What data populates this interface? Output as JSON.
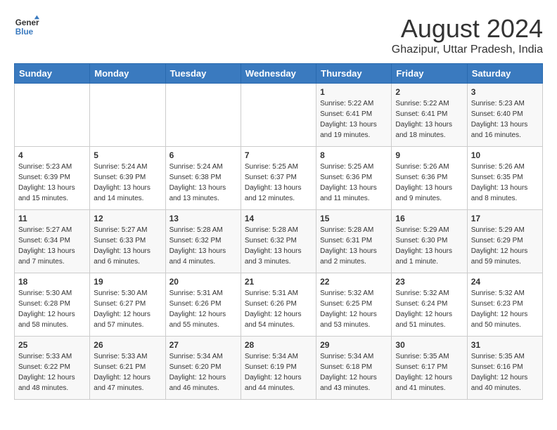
{
  "header": {
    "logo_line1": "General",
    "logo_line2": "Blue",
    "month_year": "August 2024",
    "location": "Ghazipur, Uttar Pradesh, India"
  },
  "days_of_week": [
    "Sunday",
    "Monday",
    "Tuesday",
    "Wednesday",
    "Thursday",
    "Friday",
    "Saturday"
  ],
  "weeks": [
    [
      {
        "day": "",
        "sunrise": "",
        "sunset": "",
        "daylight": ""
      },
      {
        "day": "",
        "sunrise": "",
        "sunset": "",
        "daylight": ""
      },
      {
        "day": "",
        "sunrise": "",
        "sunset": "",
        "daylight": ""
      },
      {
        "day": "",
        "sunrise": "",
        "sunset": "",
        "daylight": ""
      },
      {
        "day": "1",
        "sunrise": "Sunrise: 5:22 AM",
        "sunset": "Sunset: 6:41 PM",
        "daylight": "Daylight: 13 hours and 19 minutes."
      },
      {
        "day": "2",
        "sunrise": "Sunrise: 5:22 AM",
        "sunset": "Sunset: 6:41 PM",
        "daylight": "Daylight: 13 hours and 18 minutes."
      },
      {
        "day": "3",
        "sunrise": "Sunrise: 5:23 AM",
        "sunset": "Sunset: 6:40 PM",
        "daylight": "Daylight: 13 hours and 16 minutes."
      }
    ],
    [
      {
        "day": "4",
        "sunrise": "Sunrise: 5:23 AM",
        "sunset": "Sunset: 6:39 PM",
        "daylight": "Daylight: 13 hours and 15 minutes."
      },
      {
        "day": "5",
        "sunrise": "Sunrise: 5:24 AM",
        "sunset": "Sunset: 6:39 PM",
        "daylight": "Daylight: 13 hours and 14 minutes."
      },
      {
        "day": "6",
        "sunrise": "Sunrise: 5:24 AM",
        "sunset": "Sunset: 6:38 PM",
        "daylight": "Daylight: 13 hours and 13 minutes."
      },
      {
        "day": "7",
        "sunrise": "Sunrise: 5:25 AM",
        "sunset": "Sunset: 6:37 PM",
        "daylight": "Daylight: 13 hours and 12 minutes."
      },
      {
        "day": "8",
        "sunrise": "Sunrise: 5:25 AM",
        "sunset": "Sunset: 6:36 PM",
        "daylight": "Daylight: 13 hours and 11 minutes."
      },
      {
        "day": "9",
        "sunrise": "Sunrise: 5:26 AM",
        "sunset": "Sunset: 6:36 PM",
        "daylight": "Daylight: 13 hours and 9 minutes."
      },
      {
        "day": "10",
        "sunrise": "Sunrise: 5:26 AM",
        "sunset": "Sunset: 6:35 PM",
        "daylight": "Daylight: 13 hours and 8 minutes."
      }
    ],
    [
      {
        "day": "11",
        "sunrise": "Sunrise: 5:27 AM",
        "sunset": "Sunset: 6:34 PM",
        "daylight": "Daylight: 13 hours and 7 minutes."
      },
      {
        "day": "12",
        "sunrise": "Sunrise: 5:27 AM",
        "sunset": "Sunset: 6:33 PM",
        "daylight": "Daylight: 13 hours and 6 minutes."
      },
      {
        "day": "13",
        "sunrise": "Sunrise: 5:28 AM",
        "sunset": "Sunset: 6:32 PM",
        "daylight": "Daylight: 13 hours and 4 minutes."
      },
      {
        "day": "14",
        "sunrise": "Sunrise: 5:28 AM",
        "sunset": "Sunset: 6:32 PM",
        "daylight": "Daylight: 13 hours and 3 minutes."
      },
      {
        "day": "15",
        "sunrise": "Sunrise: 5:28 AM",
        "sunset": "Sunset: 6:31 PM",
        "daylight": "Daylight: 13 hours and 2 minutes."
      },
      {
        "day": "16",
        "sunrise": "Sunrise: 5:29 AM",
        "sunset": "Sunset: 6:30 PM",
        "daylight": "Daylight: 13 hours and 1 minute."
      },
      {
        "day": "17",
        "sunrise": "Sunrise: 5:29 AM",
        "sunset": "Sunset: 6:29 PM",
        "daylight": "Daylight: 12 hours and 59 minutes."
      }
    ],
    [
      {
        "day": "18",
        "sunrise": "Sunrise: 5:30 AM",
        "sunset": "Sunset: 6:28 PM",
        "daylight": "Daylight: 12 hours and 58 minutes."
      },
      {
        "day": "19",
        "sunrise": "Sunrise: 5:30 AM",
        "sunset": "Sunset: 6:27 PM",
        "daylight": "Daylight: 12 hours and 57 minutes."
      },
      {
        "day": "20",
        "sunrise": "Sunrise: 5:31 AM",
        "sunset": "Sunset: 6:26 PM",
        "daylight": "Daylight: 12 hours and 55 minutes."
      },
      {
        "day": "21",
        "sunrise": "Sunrise: 5:31 AM",
        "sunset": "Sunset: 6:26 PM",
        "daylight": "Daylight: 12 hours and 54 minutes."
      },
      {
        "day": "22",
        "sunrise": "Sunrise: 5:32 AM",
        "sunset": "Sunset: 6:25 PM",
        "daylight": "Daylight: 12 hours and 53 minutes."
      },
      {
        "day": "23",
        "sunrise": "Sunrise: 5:32 AM",
        "sunset": "Sunset: 6:24 PM",
        "daylight": "Daylight: 12 hours and 51 minutes."
      },
      {
        "day": "24",
        "sunrise": "Sunrise: 5:32 AM",
        "sunset": "Sunset: 6:23 PM",
        "daylight": "Daylight: 12 hours and 50 minutes."
      }
    ],
    [
      {
        "day": "25",
        "sunrise": "Sunrise: 5:33 AM",
        "sunset": "Sunset: 6:22 PM",
        "daylight": "Daylight: 12 hours and 48 minutes."
      },
      {
        "day": "26",
        "sunrise": "Sunrise: 5:33 AM",
        "sunset": "Sunset: 6:21 PM",
        "daylight": "Daylight: 12 hours and 47 minutes."
      },
      {
        "day": "27",
        "sunrise": "Sunrise: 5:34 AM",
        "sunset": "Sunset: 6:20 PM",
        "daylight": "Daylight: 12 hours and 46 minutes."
      },
      {
        "day": "28",
        "sunrise": "Sunrise: 5:34 AM",
        "sunset": "Sunset: 6:19 PM",
        "daylight": "Daylight: 12 hours and 44 minutes."
      },
      {
        "day": "29",
        "sunrise": "Sunrise: 5:34 AM",
        "sunset": "Sunset: 6:18 PM",
        "daylight": "Daylight: 12 hours and 43 minutes."
      },
      {
        "day": "30",
        "sunrise": "Sunrise: 5:35 AM",
        "sunset": "Sunset: 6:17 PM",
        "daylight": "Daylight: 12 hours and 41 minutes."
      },
      {
        "day": "31",
        "sunrise": "Sunrise: 5:35 AM",
        "sunset": "Sunset: 6:16 PM",
        "daylight": "Daylight: 12 hours and 40 minutes."
      }
    ]
  ]
}
